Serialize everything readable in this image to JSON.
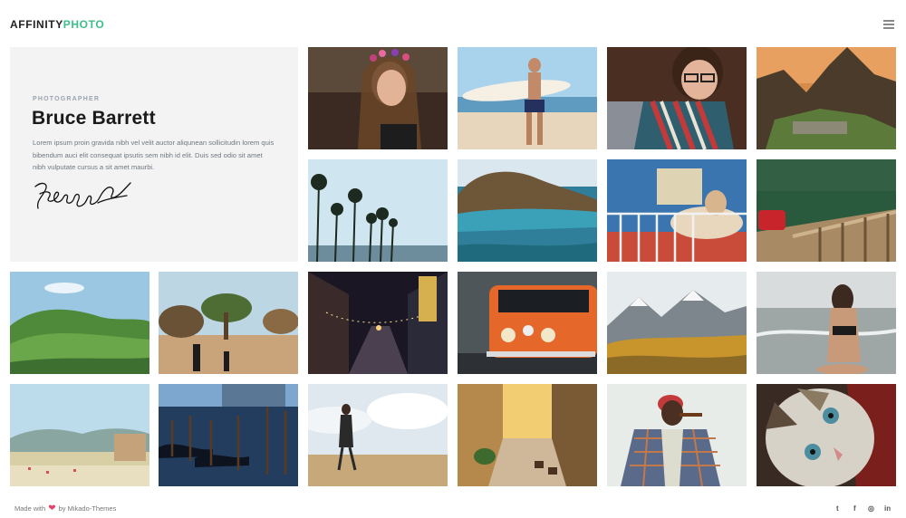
{
  "header": {
    "logo_part1": "AFFINITY",
    "logo_part2": "PHOTO",
    "menu_icon": "hamburger-icon"
  },
  "intro": {
    "eyebrow": "PHOTOGRAPHER",
    "name": "Bruce Barrett",
    "description": "Lorem ipsum proin gravida nibh vel velit auctor aliqunean sollicitudin lorem quis bibendum auci elit consequat ipsutis sem nibh id elit. Duis sed odio sit amet nibh vulputate cursus a sit amet maurbi."
  },
  "gallery": {
    "items": [
      {
        "subject": "woman with flower crown"
      },
      {
        "subject": "surfer on beach"
      },
      {
        "subject": "man with scarf"
      },
      {
        "subject": "machu picchu mountain"
      },
      {
        "subject": "palm trees"
      },
      {
        "subject": "coastal cliffs"
      },
      {
        "subject": "dog behind railing"
      },
      {
        "subject": "red car on bridge"
      },
      {
        "subject": "green valley"
      },
      {
        "subject": "village trees"
      },
      {
        "subject": "night street lights"
      },
      {
        "subject": "orange vw van"
      },
      {
        "subject": "autumn mountains"
      },
      {
        "subject": "woman on beach"
      },
      {
        "subject": "coastal city"
      },
      {
        "subject": "venice gondolas"
      },
      {
        "subject": "woman walking on beach"
      },
      {
        "subject": "narrow alley street"
      },
      {
        "subject": "man with cigar"
      },
      {
        "subject": "cat close-up"
      }
    ]
  },
  "footer": {
    "made_with": "Made with",
    "by": "by Mikado-Themes",
    "social": [
      {
        "icon": "twitter-icon",
        "glyph": "t"
      },
      {
        "icon": "facebook-icon",
        "glyph": "f"
      },
      {
        "icon": "instagram-icon",
        "glyph": "◎"
      },
      {
        "icon": "linkedin-icon",
        "glyph": "in"
      }
    ]
  },
  "colors": {
    "accent": "#3dbf8a",
    "heart": "#e0446b",
    "intro_bg": "#f3f3f3"
  }
}
